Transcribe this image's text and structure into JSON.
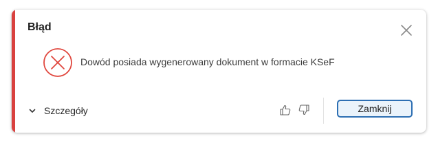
{
  "dialog": {
    "title": "Błąd",
    "message": "Dowód posiada wygenerowany dokument w formacie KSeF",
    "details_label": "Szczegóły",
    "primary_button_label": "Zamknij",
    "icons": {
      "close": "close-icon",
      "error": "error-circle-x-icon",
      "details": "chevron-down-icon",
      "like": "thumbs-up-icon",
      "dislike": "thumbs-down-icon"
    },
    "colors": {
      "accent": "#d9413f",
      "error_icon": "#e0463d",
      "primary_border": "#2d6fb3",
      "primary_fill": "#eaf3fb"
    }
  }
}
